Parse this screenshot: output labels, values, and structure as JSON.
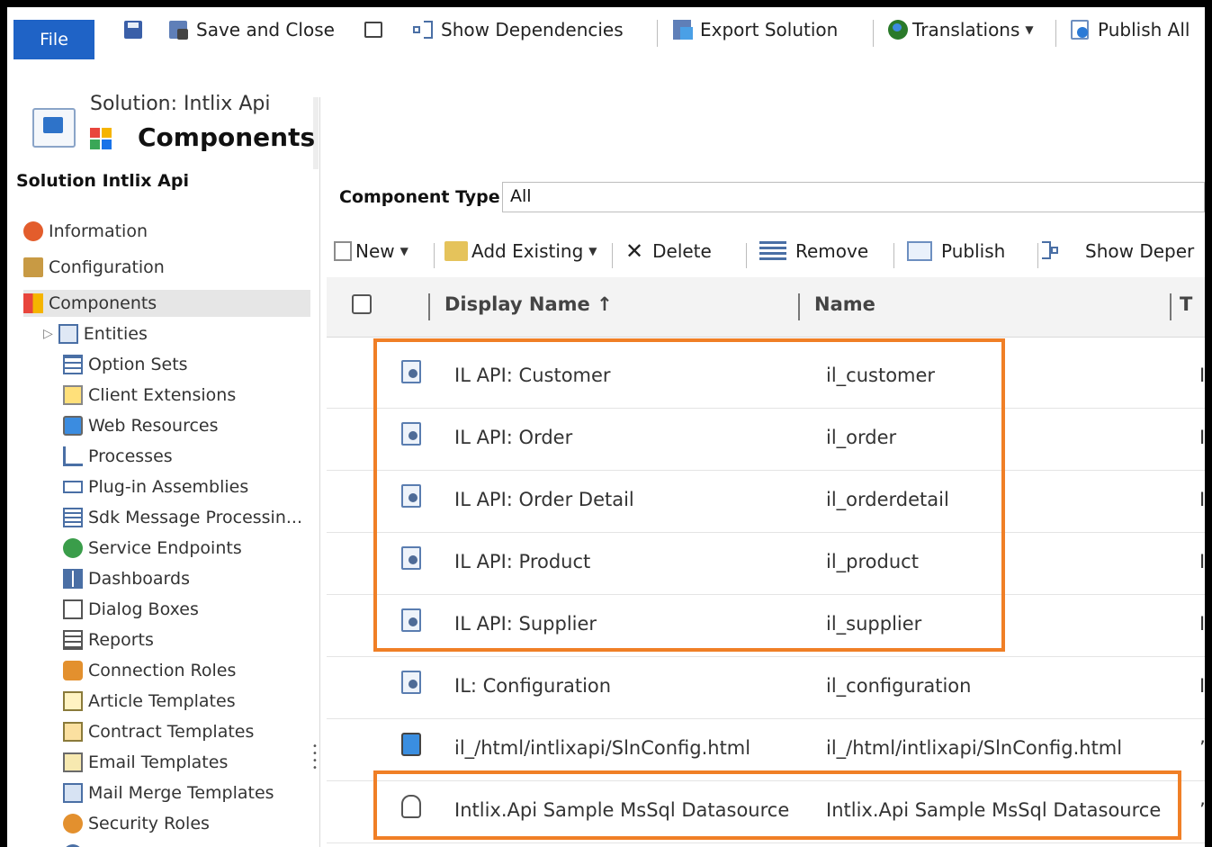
{
  "ribbon": {
    "file_label": "File",
    "save_close_label": "Save and Close",
    "show_dependencies_label": "Show Dependencies",
    "export_solution_label": "Export Solution",
    "translations_label": "Translations",
    "publish_all_label": "Publish All"
  },
  "header": {
    "solution_label": "Solution: Intlix Api",
    "title": "Components"
  },
  "nav": {
    "heading": "Solution Intlix Api",
    "items": [
      {
        "label": "Information",
        "icon": "information-icon"
      },
      {
        "label": "Configuration",
        "icon": "configuration-icon"
      },
      {
        "label": "Components",
        "icon": "components-icon"
      },
      {
        "label": "Entities",
        "icon": "entities-icon"
      },
      {
        "label": "Option Sets",
        "icon": "option-sets-icon"
      },
      {
        "label": "Client Extensions",
        "icon": "client-extensions-icon"
      },
      {
        "label": "Web Resources",
        "icon": "web-resources-icon"
      },
      {
        "label": "Processes",
        "icon": "processes-icon"
      },
      {
        "label": "Plug-in Assemblies",
        "icon": "plugin-assemblies-icon"
      },
      {
        "label": "Sdk Message Processin...",
        "icon": "sdk-message-icon"
      },
      {
        "label": "Service Endpoints",
        "icon": "service-endpoints-icon"
      },
      {
        "label": "Dashboards",
        "icon": "dashboards-icon"
      },
      {
        "label": "Dialog Boxes",
        "icon": "dialog-boxes-icon"
      },
      {
        "label": "Reports",
        "icon": "reports-icon"
      },
      {
        "label": "Connection Roles",
        "icon": "connection-roles-icon"
      },
      {
        "label": "Article Templates",
        "icon": "article-templates-icon"
      },
      {
        "label": "Contract Templates",
        "icon": "contract-templates-icon"
      },
      {
        "label": "Email Templates",
        "icon": "email-templates-icon"
      },
      {
        "label": "Mail Merge Templates",
        "icon": "mail-merge-templates-icon"
      },
      {
        "label": "Security Roles",
        "icon": "security-roles-icon"
      }
    ]
  },
  "filter": {
    "label": "Component Type",
    "value": "All"
  },
  "toolbar": {
    "new_label": "New",
    "add_existing_label": "Add Existing",
    "delete_label": "Delete",
    "remove_label": "Remove",
    "publish_label": "Publish",
    "show_dependencies_label": "Show Deper"
  },
  "grid": {
    "columns": {
      "display_name": "Display Name ↑",
      "name": "Name",
      "type": "T"
    },
    "rows": [
      {
        "display_name": "IL API: Customer",
        "name": "il_customer",
        "type": "I",
        "icon": "entity-icon"
      },
      {
        "display_name": "IL API: Order",
        "name": "il_order",
        "type": "I",
        "icon": "entity-icon"
      },
      {
        "display_name": "IL API: Order Detail",
        "name": "il_orderdetail",
        "type": "I",
        "icon": "entity-icon"
      },
      {
        "display_name": "IL API: Product",
        "name": "il_product",
        "type": "I",
        "icon": "entity-icon"
      },
      {
        "display_name": "IL API: Supplier",
        "name": "il_supplier",
        "type": "I",
        "icon": "entity-icon"
      },
      {
        "display_name": "IL: Configuration",
        "name": "il_configuration",
        "type": "I",
        "icon": "entity-icon"
      },
      {
        "display_name": "il_/html/intlixapi/SlnConfig.html",
        "name": "il_/html/intlixapi/SlnConfig.html",
        "type": "’",
        "icon": "web-resource-icon"
      },
      {
        "display_name": "Intlix.Api Sample MsSql Datasource",
        "name": "Intlix.Api Sample MsSql Datasource",
        "type": "’",
        "icon": "datasource-icon"
      }
    ]
  },
  "colors": {
    "highlight": "#f07f26",
    "file_button": "#1f63c6"
  }
}
